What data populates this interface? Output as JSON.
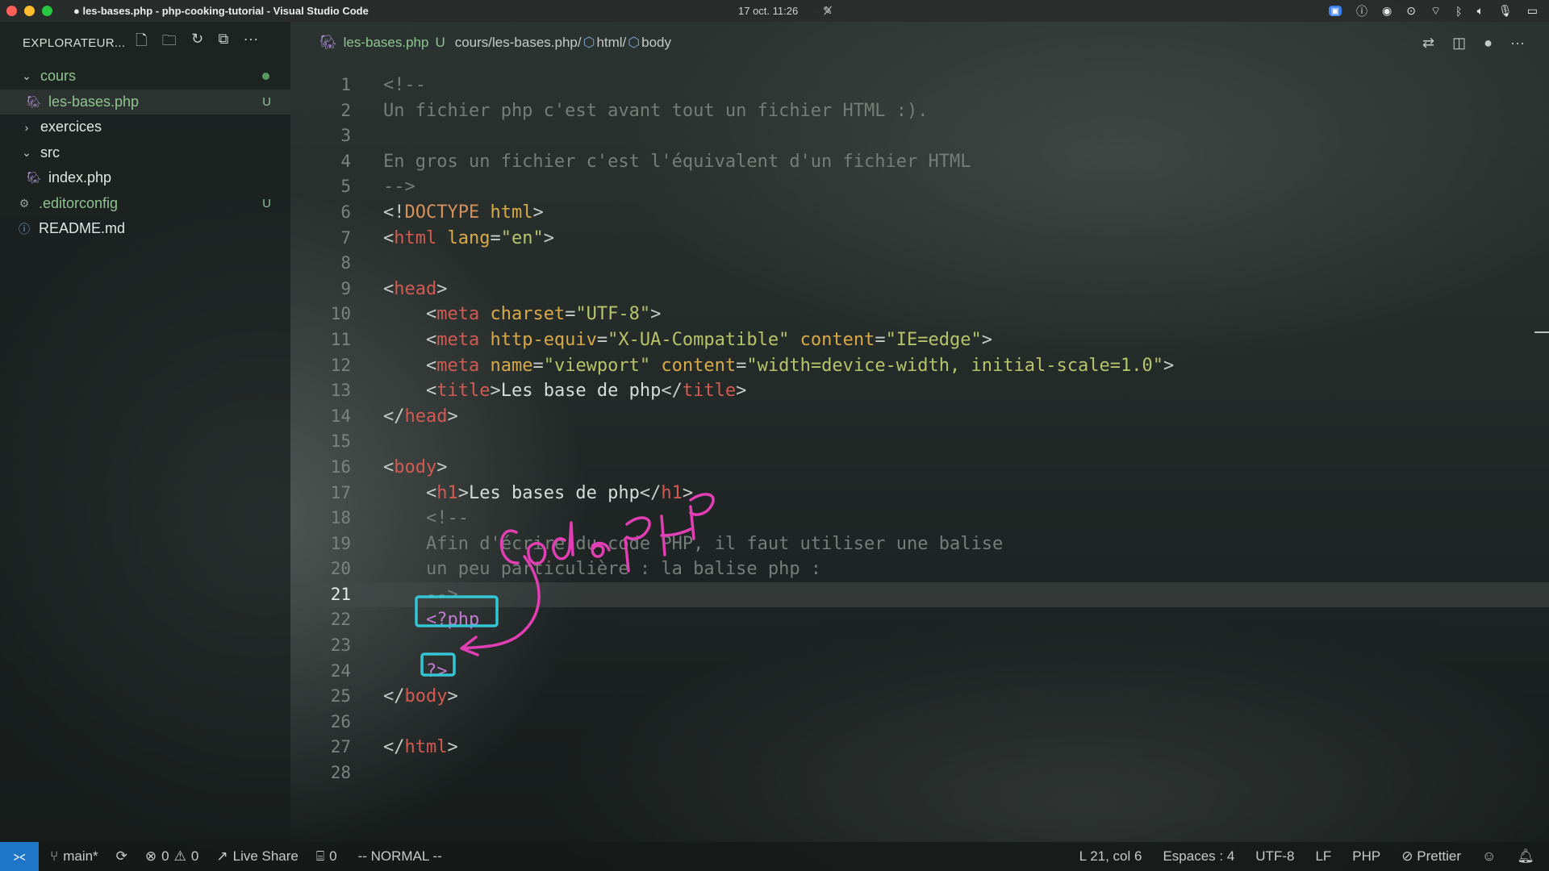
{
  "menubar": {
    "window_title": "● les-bases.php - php-cooking-tutorial - Visual Studio Code",
    "clock": "17 oct.  11:26"
  },
  "sidebar": {
    "title": "EXPLORATEUR...",
    "items": [
      {
        "label": "cours",
        "kind": "folder-open",
        "status": "dot"
      },
      {
        "label": "les-bases.php",
        "kind": "php",
        "status": "U"
      },
      {
        "label": "exercices",
        "kind": "folder-closed",
        "status": ""
      },
      {
        "label": "src",
        "kind": "folder-open",
        "status": ""
      },
      {
        "label": "index.php",
        "kind": "php",
        "status": ""
      },
      {
        "label": ".editorconfig",
        "kind": "gear",
        "status": "U"
      },
      {
        "label": "README.md",
        "kind": "info",
        "status": ""
      }
    ]
  },
  "editor": {
    "tab_name": "les-bases.php",
    "tab_status": "U",
    "breadcrumb": [
      "cours/les-bases.php/",
      "html/",
      "body"
    ],
    "current_line": 21,
    "code": [
      [
        {
          "t": "<!--",
          "c": "com"
        }
      ],
      [
        {
          "t": "Un fichier php c'est avant tout un fichier HTML :).",
          "c": "com"
        }
      ],
      [],
      [
        {
          "t": "En gros un fichier c'est l'équivalent d'un fichier HTML",
          "c": "com"
        }
      ],
      [
        {
          "t": "-->",
          "c": "com"
        }
      ],
      [
        {
          "t": "<!",
          "c": "br"
        },
        {
          "t": "DOCTYPE",
          "c": "doc"
        },
        {
          "t": " html",
          "c": "attr"
        },
        {
          "t": ">",
          "c": "br"
        }
      ],
      [
        {
          "t": "<",
          "c": "br"
        },
        {
          "t": "html",
          "c": "tag"
        },
        {
          "t": " lang",
          "c": "attr"
        },
        {
          "t": "=",
          "c": "br"
        },
        {
          "t": "\"en\"",
          "c": "str"
        },
        {
          "t": ">",
          "c": "br"
        }
      ],
      [],
      [
        {
          "t": "<",
          "c": "br"
        },
        {
          "t": "head",
          "c": "tag"
        },
        {
          "t": ">",
          "c": "br"
        }
      ],
      [
        {
          "t": "    <",
          "c": "br"
        },
        {
          "t": "meta",
          "c": "tag"
        },
        {
          "t": " charset",
          "c": "attr"
        },
        {
          "t": "=",
          "c": "br"
        },
        {
          "t": "\"UTF-8\"",
          "c": "str"
        },
        {
          "t": ">",
          "c": "br"
        }
      ],
      [
        {
          "t": "    <",
          "c": "br"
        },
        {
          "t": "meta",
          "c": "tag"
        },
        {
          "t": " http-equiv",
          "c": "attr"
        },
        {
          "t": "=",
          "c": "br"
        },
        {
          "t": "\"X-UA-Compatible\"",
          "c": "str"
        },
        {
          "t": " content",
          "c": "attr"
        },
        {
          "t": "=",
          "c": "br"
        },
        {
          "t": "\"IE=edge\"",
          "c": "str"
        },
        {
          "t": ">",
          "c": "br"
        }
      ],
      [
        {
          "t": "    <",
          "c": "br"
        },
        {
          "t": "meta",
          "c": "tag"
        },
        {
          "t": " name",
          "c": "attr"
        },
        {
          "t": "=",
          "c": "br"
        },
        {
          "t": "\"viewport\"",
          "c": "str"
        },
        {
          "t": " content",
          "c": "attr"
        },
        {
          "t": "=",
          "c": "br"
        },
        {
          "t": "\"width=device-width, initial-scale=1.0\"",
          "c": "str"
        },
        {
          "t": ">",
          "c": "br"
        }
      ],
      [
        {
          "t": "    <",
          "c": "br"
        },
        {
          "t": "title",
          "c": "tag"
        },
        {
          "t": ">",
          "c": "br"
        },
        {
          "t": "Les base de php",
          "c": "txt"
        },
        {
          "t": "</",
          "c": "br"
        },
        {
          "t": "title",
          "c": "tag"
        },
        {
          "t": ">",
          "c": "br"
        }
      ],
      [
        {
          "t": "</",
          "c": "br"
        },
        {
          "t": "head",
          "c": "tag"
        },
        {
          "t": ">",
          "c": "br"
        }
      ],
      [],
      [
        {
          "t": "<",
          "c": "br"
        },
        {
          "t": "body",
          "c": "tag"
        },
        {
          "t": ">",
          "c": "br"
        }
      ],
      [
        {
          "t": "    <",
          "c": "br"
        },
        {
          "t": "h1",
          "c": "tag"
        },
        {
          "t": ">",
          "c": "br"
        },
        {
          "t": "Les bases de php",
          "c": "txt"
        },
        {
          "t": "</",
          "c": "br"
        },
        {
          "t": "h1",
          "c": "tag"
        },
        {
          "t": ">",
          "c": "br"
        }
      ],
      [
        {
          "t": "    <!--",
          "c": "com"
        }
      ],
      [
        {
          "t": "    Afin d'écrire du code PHP, il faut utiliser une balise",
          "c": "com"
        }
      ],
      [
        {
          "t": "    un peu particulière : la balise php :",
          "c": "com"
        }
      ],
      [
        {
          "t": "    -->",
          "c": "com"
        }
      ],
      [
        {
          "t": "    <?php",
          "c": "php"
        }
      ],
      [],
      [
        {
          "t": "    ?>",
          "c": "php"
        }
      ],
      [
        {
          "t": "</",
          "c": "br"
        },
        {
          "t": "body",
          "c": "tag"
        },
        {
          "t": ">",
          "c": "br"
        }
      ],
      [],
      [
        {
          "t": "</",
          "c": "br"
        },
        {
          "t": "html",
          "c": "tag"
        },
        {
          "t": ">",
          "c": "br"
        }
      ],
      []
    ]
  },
  "annotation": {
    "handwritten_text": "Code PHP",
    "ink_color": "#e23fb4",
    "box_color": "#35c6d6"
  },
  "statusbar": {
    "branch": "main*",
    "errors": "0",
    "warnings": "0",
    "live_share": "Live Share",
    "ports": "0",
    "mode": "-- NORMAL --",
    "cursor": "L 21, col 6",
    "indent": "Espaces : 4",
    "encoding": "UTF-8",
    "eol": "LF",
    "language": "PHP",
    "formatter": "Prettier"
  },
  "colors": {
    "accent": "#1f76c9",
    "git_added": "#8fc48f"
  }
}
